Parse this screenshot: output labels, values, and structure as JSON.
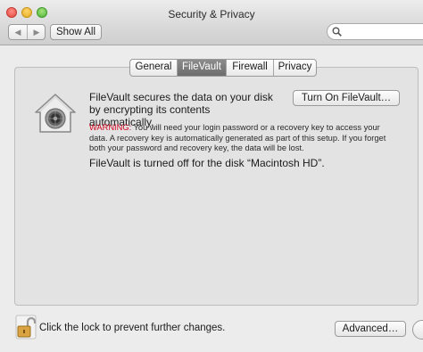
{
  "window": {
    "title": "Security & Privacy"
  },
  "toolbar": {
    "back_icon": "chevron-left-icon",
    "forward_icon": "chevron-right-icon",
    "show_all_label": "Show All",
    "search_placeholder": ""
  },
  "tabs": [
    {
      "label": "General",
      "selected": false
    },
    {
      "label": "FileVault",
      "selected": true
    },
    {
      "label": "Firewall",
      "selected": false
    },
    {
      "label": "Privacy",
      "selected": false
    }
  ],
  "filevault": {
    "icon": "filevault-house-vault-icon",
    "description": "FileVault secures the data on your disk by encrypting its contents automatically.",
    "turn_on_label": "Turn On FileVault…",
    "warning_label": "WARNING:",
    "warning_text": " You will need your login password or a recovery key to access your data. A recovery key is automatically generated as part of this setup. If you forget both your password and recovery key, the data will be lost.",
    "status": "FileVault is turned off for the disk “Macintosh HD”."
  },
  "footer": {
    "lock_icon": "unlocked-padlock-icon",
    "lock_text": "Click the lock to prevent further changes.",
    "advanced_label": "Advanced…"
  },
  "colors": {
    "warning": "#d0021b",
    "selected_tab": "#7a7a7a"
  }
}
